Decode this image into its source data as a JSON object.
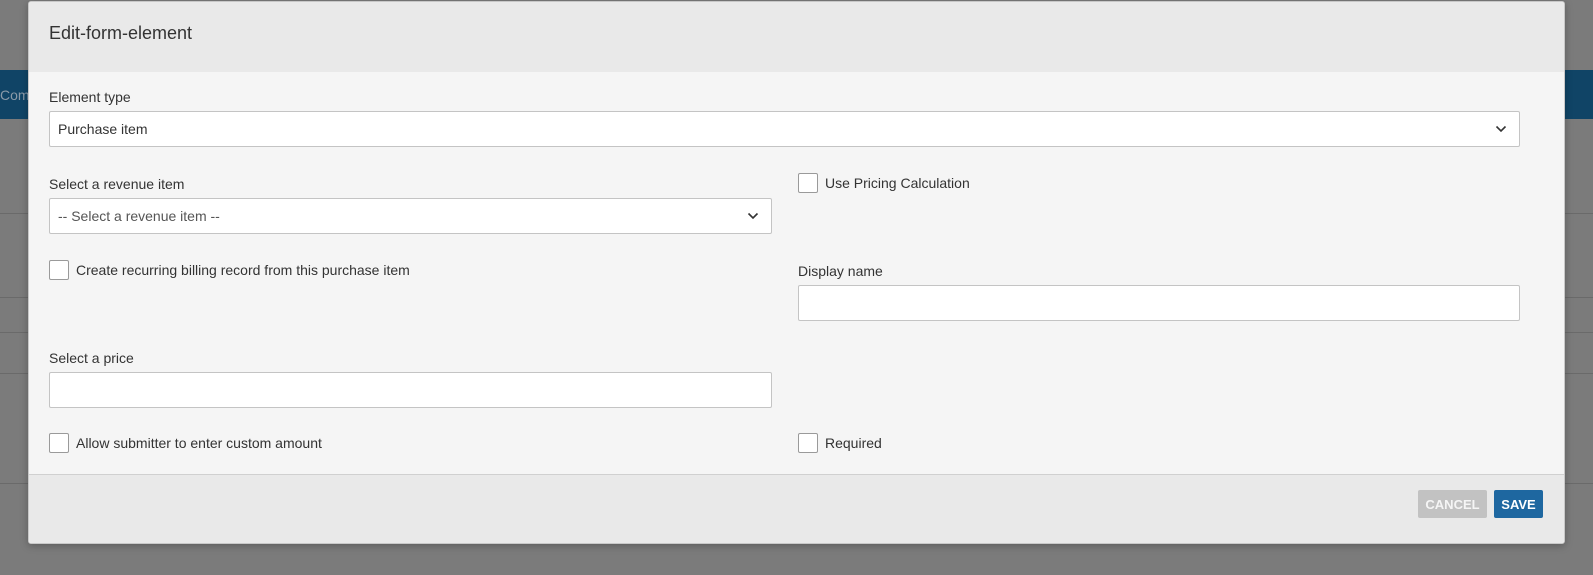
{
  "background": {
    "nav_partial_text": "Com"
  },
  "modal": {
    "title": "Edit-form-element",
    "element_type": {
      "label": "Element type",
      "value": "Purchase item"
    },
    "revenue_item": {
      "label": "Select a revenue item",
      "placeholder": "-- Select a revenue item --"
    },
    "use_pricing_calculation": {
      "label": "Use Pricing Calculation",
      "checked": false
    },
    "recurring_billing": {
      "label": "Create recurring billing record from this purchase item",
      "checked": false
    },
    "display_name": {
      "label": "Display name",
      "value": ""
    },
    "price": {
      "label": "Select a price",
      "value": ""
    },
    "custom_amount": {
      "label": "Allow submitter to enter custom amount",
      "checked": false
    },
    "required": {
      "label": "Required",
      "checked": false
    },
    "footer": {
      "cancel_label": "CANCEL",
      "save_label": "SAVE"
    }
  },
  "colors": {
    "primary": "#1e67a0",
    "navbar": "#104466",
    "cancel": "#c2c2c2"
  }
}
